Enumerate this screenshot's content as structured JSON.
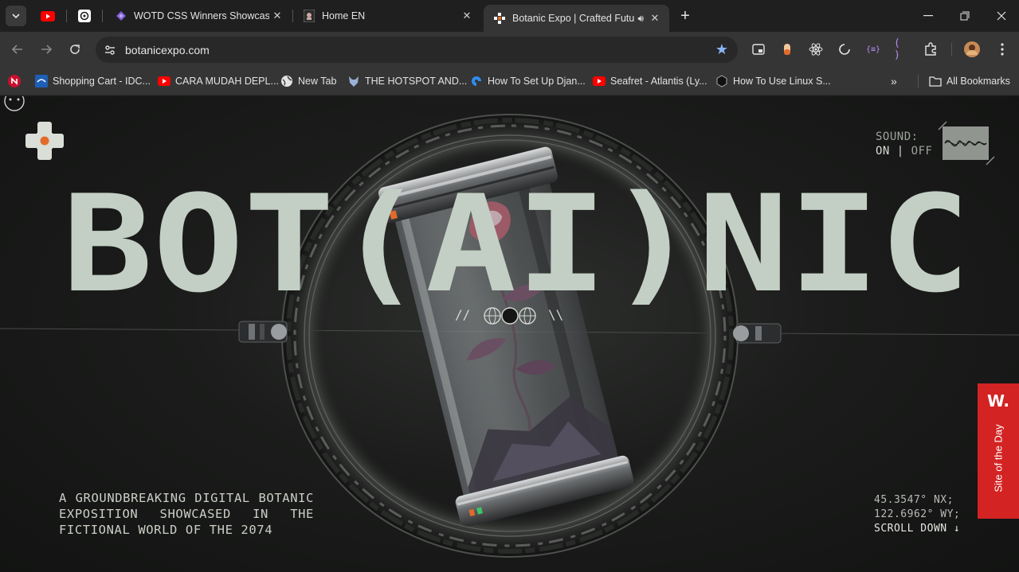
{
  "browser": {
    "tabs": [
      {
        "title": "WOTD CSS Winners Showcase -",
        "icon": "wotd-icon"
      },
      {
        "title": "Home EN",
        "icon": "page-icon"
      },
      {
        "title": "Botanic Expo | Crafted Futur",
        "icon": "botanic-icon",
        "active": true,
        "audio": "speaker-icon"
      }
    ],
    "pinned": [
      "youtube-icon",
      "openai-icon"
    ],
    "url": "botanicexpo.com",
    "bookmarks": [
      {
        "label": "",
        "icon": "n-icon"
      },
      {
        "label": "Shopping Cart - IDC...",
        "icon": "cart-icon"
      },
      {
        "label": "CARA MUDAH DEPL...",
        "icon": "youtube-icon"
      },
      {
        "label": "New Tab",
        "icon": "globe-icon"
      },
      {
        "label": "THE HOTSPOT AND...",
        "icon": "fox-icon"
      },
      {
        "label": "How To Set Up Djan...",
        "icon": "digitalocean-icon"
      },
      {
        "label": "Seafret - Atlantis (Ly...",
        "icon": "youtube-icon"
      },
      {
        "label": "How To Use Linux S...",
        "icon": "hex-icon"
      }
    ],
    "all_bookmarks": "All Bookmarks"
  },
  "page": {
    "title_text": "BOT(AI)NIC",
    "center_marks": {
      "left": "//",
      "right": "\\\\"
    },
    "sound": {
      "label": "SOUND:",
      "on": "ON",
      "sep": "|",
      "off": "OFF"
    },
    "tagline": "A GROUNDBREAKING DIGITAL BOTANIC EXPOSITION SHOWCASED IN THE FICTIONAL WORLD OF THE 2074",
    "coords": {
      "lat": "45.3547° NX;",
      "lon": "122.6962° WY;",
      "scroll": "SCROLL DOWN ↓"
    },
    "award": {
      "logo": "W.",
      "label": "Site of the Day"
    }
  },
  "colors": {
    "title": "#c3cfc4",
    "award": "#d32323",
    "accent": "#e26b2a"
  }
}
